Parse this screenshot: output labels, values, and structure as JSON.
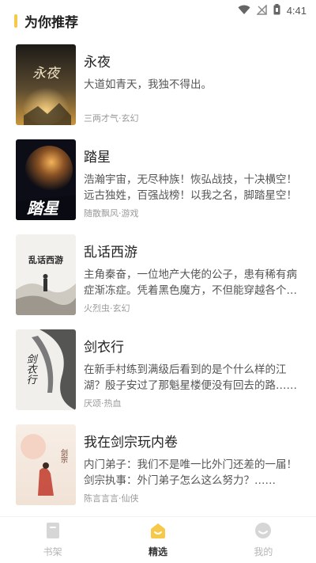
{
  "status_bar": {
    "time": "4:41"
  },
  "section": {
    "title": "为你推荐"
  },
  "books": [
    {
      "title": "永夜",
      "desc": "大道如青天，我独不得出。",
      "meta": "三两才气·玄幻",
      "cover_text": "永夜"
    },
    {
      "title": "踏星",
      "desc": "浩瀚宇宙，无尽种族！恢弘战技，十决横空！远古独姓，百强战榜！以我之名，脚踏星空！",
      "meta": "随散飘风·游戏",
      "cover_text": "踏星"
    },
    {
      "title": "乱话西游",
      "desc": "主角秦奋，一位地产大佬的公子，患有稀有病症渐冻症。凭着黑色魔方，不但能穿越各个时空……",
      "meta": "火烈虫·玄幻",
      "cover_text": "乱话西游"
    },
    {
      "title": "剑衣行",
      "desc": "在新手村练到满级后看到的是个什么样的江湖？殷子安过了那魁星楼便没有回去的路……",
      "meta": "厌颂·热血",
      "cover_text": "剑衣行"
    },
    {
      "title": "我在剑宗玩内卷",
      "desc": "内门弟子：我们不是唯一比外门还差的一届！剑宗执事：外门弟子怎么这么努力？……",
      "meta": "陈言言言·仙侠",
      "cover_text": "剑宗"
    }
  ],
  "nav": {
    "bookshelf": "书架",
    "featured": "精选",
    "mine": "我的"
  },
  "colors": {
    "accent": "#f6c94a"
  }
}
